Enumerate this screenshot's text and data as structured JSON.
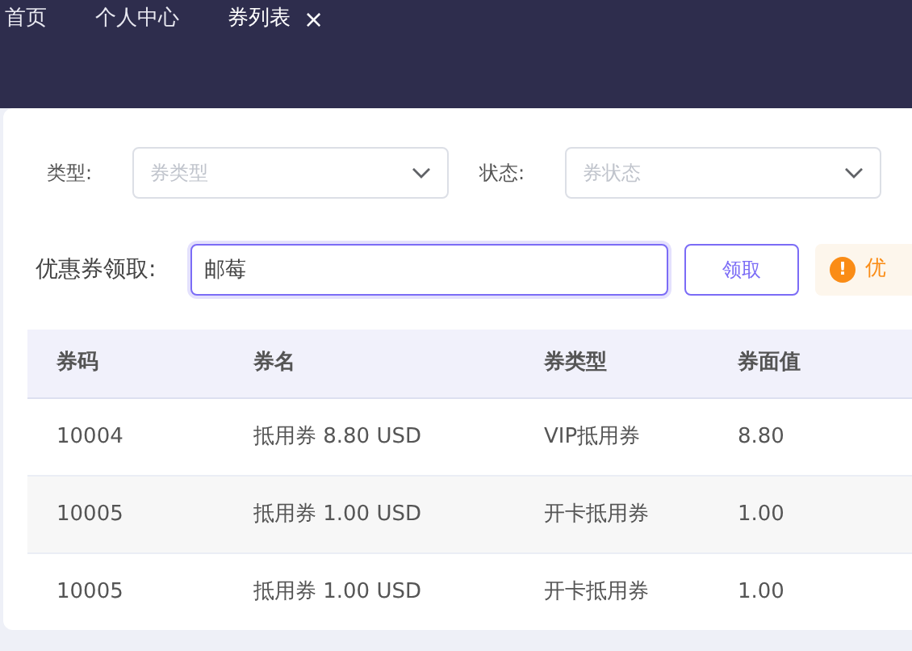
{
  "tabs": [
    {
      "label": "首页",
      "selected": false
    },
    {
      "label": "个人中心",
      "selected": false
    },
    {
      "label": "券列表",
      "selected": true,
      "close_glyph": "×"
    }
  ],
  "filters": [
    {
      "label": "类型:",
      "placeholder": "券类型"
    },
    {
      "label": "状态:",
      "placeholder": "券状态"
    }
  ],
  "claim": {
    "label": "优惠券领取:",
    "value": "邮莓",
    "button": "领取",
    "alert_icon": "!",
    "alert": "优"
  },
  "table": {
    "columns": [
      "券码",
      "券名",
      "券类型",
      "券面值"
    ],
    "rows": [
      [
        "10004",
        "抵用券 8.80 USD",
        "VIP抵用券",
        "8.80"
      ],
      [
        "10005",
        "抵用券 1.00 USD",
        "开卡抵用券",
        "1.00"
      ],
      [
        "10005",
        "抵用券 1.00 USD",
        "开卡抵用券",
        "1.00"
      ]
    ]
  }
}
